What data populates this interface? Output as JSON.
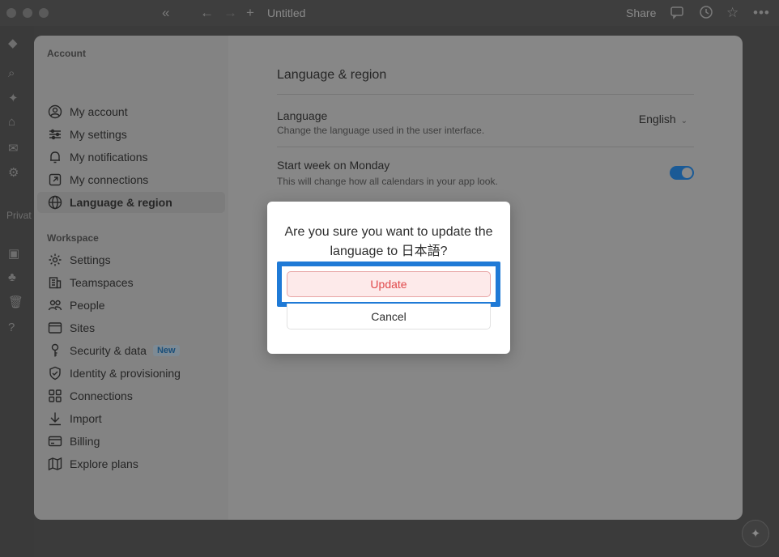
{
  "titlebar": {
    "page_title": "Untitled",
    "share_label": "Share"
  },
  "app_sidebar": {
    "private_label": "Privat"
  },
  "settings_nav": {
    "account_section": "Account",
    "account_items": [
      {
        "label": "My account"
      },
      {
        "label": "My settings"
      },
      {
        "label": "My notifications"
      },
      {
        "label": "My connections"
      },
      {
        "label": "Language & region"
      }
    ],
    "workspace_section": "Workspace",
    "workspace_items": [
      {
        "label": "Settings"
      },
      {
        "label": "Teamspaces"
      },
      {
        "label": "People"
      },
      {
        "label": "Sites"
      },
      {
        "label": "Security & data",
        "badge": "New"
      },
      {
        "label": "Identity & provisioning"
      },
      {
        "label": "Connections"
      },
      {
        "label": "Import"
      },
      {
        "label": "Billing"
      },
      {
        "label": "Explore plans"
      }
    ]
  },
  "content": {
    "title": "Language & region",
    "language": {
      "title": "Language",
      "description": "Change the language used in the user interface.",
      "value": "English"
    },
    "week": {
      "title": "Start week on Monday",
      "description": "This will change how all calendars in your app look.",
      "enabled": true
    }
  },
  "dialog": {
    "message": "Are you sure you want to update the language to 日本語?",
    "update_label": "Update",
    "cancel_label": "Cancel"
  },
  "colors": {
    "highlight": "#1f7ad6",
    "update_text": "#e0484a",
    "toggle_on": "#1a5a96"
  }
}
